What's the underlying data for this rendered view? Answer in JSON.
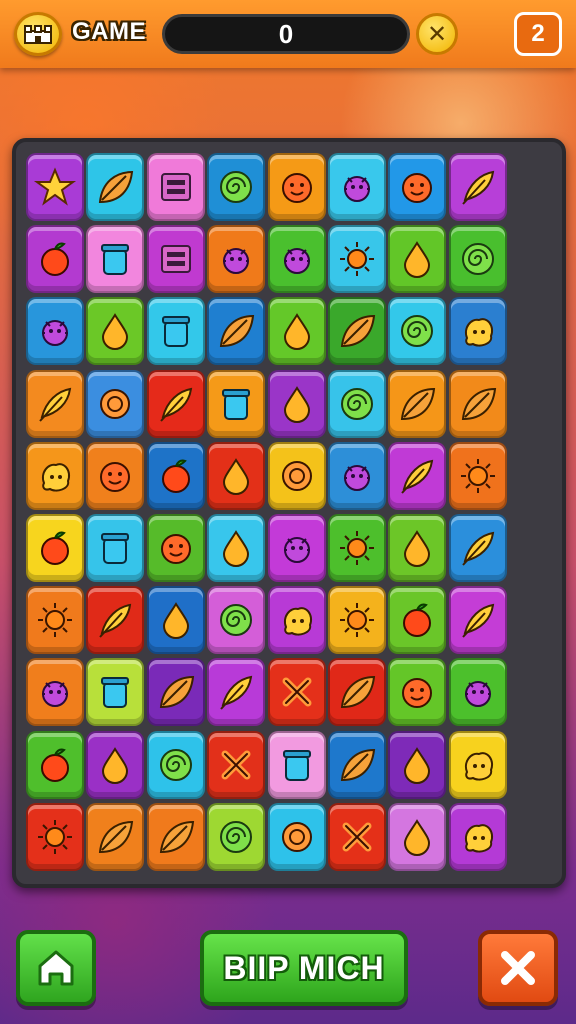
{
  "header": {
    "title": "GAME",
    "score": "0",
    "level_badge": "2",
    "logo_icon": "castle-icon",
    "close_icon": "x-icon"
  },
  "board": {
    "rows": 10,
    "cols": 8,
    "tiles": [
      {
        "color": "#a93bd6",
        "icon": "star"
      },
      {
        "color": "#2ec5e8",
        "icon": "leaf"
      },
      {
        "color": "#f07ad9",
        "icon": "box"
      },
      {
        "color": "#1f8fd6",
        "icon": "swirl"
      },
      {
        "color": "#f59a16",
        "icon": "face"
      },
      {
        "color": "#39c8ec",
        "icon": "bug"
      },
      {
        "color": "#2298e8",
        "icon": "face"
      },
      {
        "color": "#b73fd8",
        "icon": "feather"
      },
      {
        "color": "#b33ad0",
        "icon": "fruit"
      },
      {
        "color": "#f286de",
        "icon": "jar"
      },
      {
        "color": "#c03ad0",
        "icon": "box"
      },
      {
        "color": "#f07a1a",
        "icon": "bug"
      },
      {
        "color": "#4ac02e",
        "icon": "bug"
      },
      {
        "color": "#38c6ea",
        "icon": "sun"
      },
      {
        "color": "#62c628",
        "icon": "drop"
      },
      {
        "color": "#49bf2e",
        "icon": "swirl"
      },
      {
        "color": "#2896dc",
        "icon": "bug"
      },
      {
        "color": "#6bc827",
        "icon": "drop"
      },
      {
        "color": "#33c8ea",
        "icon": "jar"
      },
      {
        "color": "#1f7fd0",
        "icon": "leaf"
      },
      {
        "color": "#64c829",
        "icon": "drop"
      },
      {
        "color": "#3aa82b",
        "icon": "leaf"
      },
      {
        "color": "#33c8ea",
        "icon": "swirl"
      },
      {
        "color": "#2b7fd0",
        "icon": "blob"
      },
      {
        "color": "#f38a1f",
        "icon": "feather"
      },
      {
        "color": "#3b8ee0",
        "icon": "ring"
      },
      {
        "color": "#e52a1a",
        "icon": "feather"
      },
      {
        "color": "#f59a18",
        "icon": "jar"
      },
      {
        "color": "#9a35c8",
        "icon": "drop"
      },
      {
        "color": "#37c3ea",
        "icon": "swirl"
      },
      {
        "color": "#f59618",
        "icon": "leaf"
      },
      {
        "color": "#f28a1a",
        "icon": "leaf"
      },
      {
        "color": "#f5961a",
        "icon": "blob"
      },
      {
        "color": "#f0801c",
        "icon": "face"
      },
      {
        "color": "#1e73c8",
        "icon": "fruit"
      },
      {
        "color": "#e33018",
        "icon": "drop"
      },
      {
        "color": "#f4c21a",
        "icon": "ring"
      },
      {
        "color": "#2d8fd8",
        "icon": "bug"
      },
      {
        "color": "#c03ad6",
        "icon": "feather"
      },
      {
        "color": "#f0721c",
        "icon": "sun"
      },
      {
        "color": "#f7d51e",
        "icon": "fruit"
      },
      {
        "color": "#36c4ea",
        "icon": "jar"
      },
      {
        "color": "#56bb2a",
        "icon": "face"
      },
      {
        "color": "#38c6ec",
        "icon": "drop"
      },
      {
        "color": "#c33ad8",
        "icon": "bug"
      },
      {
        "color": "#4dbf2c",
        "icon": "sun"
      },
      {
        "color": "#6cc628",
        "icon": "drop"
      },
      {
        "color": "#2b8fdc",
        "icon": "feather"
      },
      {
        "color": "#f07a1c",
        "icon": "sun"
      },
      {
        "color": "#e02a18",
        "icon": "feather"
      },
      {
        "color": "#1f6fc8",
        "icon": "drop"
      },
      {
        "color": "#d45ed8",
        "icon": "swirl"
      },
      {
        "color": "#b83ad6",
        "icon": "blob"
      },
      {
        "color": "#f4b21c",
        "icon": "sun"
      },
      {
        "color": "#6ac629",
        "icon": "fruit"
      },
      {
        "color": "#c43dd6",
        "icon": "feather"
      },
      {
        "color": "#f07e1c",
        "icon": "bug"
      },
      {
        "color": "#b8e03a",
        "icon": "jar"
      },
      {
        "color": "#7a2ab8",
        "icon": "leaf"
      },
      {
        "color": "#b83ad8",
        "icon": "feather"
      },
      {
        "color": "#e4301a",
        "icon": "cross"
      },
      {
        "color": "#e02818",
        "icon": "leaf"
      },
      {
        "color": "#64c628",
        "icon": "face"
      },
      {
        "color": "#4cc02c",
        "icon": "bug"
      },
      {
        "color": "#4fbf2c",
        "icon": "fruit"
      },
      {
        "color": "#9a30c6",
        "icon": "drop"
      },
      {
        "color": "#2ec2ea",
        "icon": "swirl"
      },
      {
        "color": "#e2301a",
        "icon": "cross"
      },
      {
        "color": "#f29ae0",
        "icon": "jar"
      },
      {
        "color": "#1e78cc",
        "icon": "leaf"
      },
      {
        "color": "#7e2ab8",
        "icon": "drop"
      },
      {
        "color": "#f7d21e",
        "icon": "blob"
      },
      {
        "color": "#e4301a",
        "icon": "sun"
      },
      {
        "color": "#f0801c",
        "icon": "leaf"
      },
      {
        "color": "#f07a1c",
        "icon": "leaf"
      },
      {
        "color": "#9ed832",
        "icon": "swirl"
      },
      {
        "color": "#2ec2ea",
        "icon": "ring"
      },
      {
        "color": "#e43018",
        "icon": "cross"
      },
      {
        "color": "#d476e0",
        "icon": "drop"
      },
      {
        "color": "#b43ad6",
        "icon": "blob"
      }
    ]
  },
  "footer": {
    "home_icon": "home-icon",
    "action_label": "BIIP MICH",
    "close_icon": "x-icon"
  }
}
